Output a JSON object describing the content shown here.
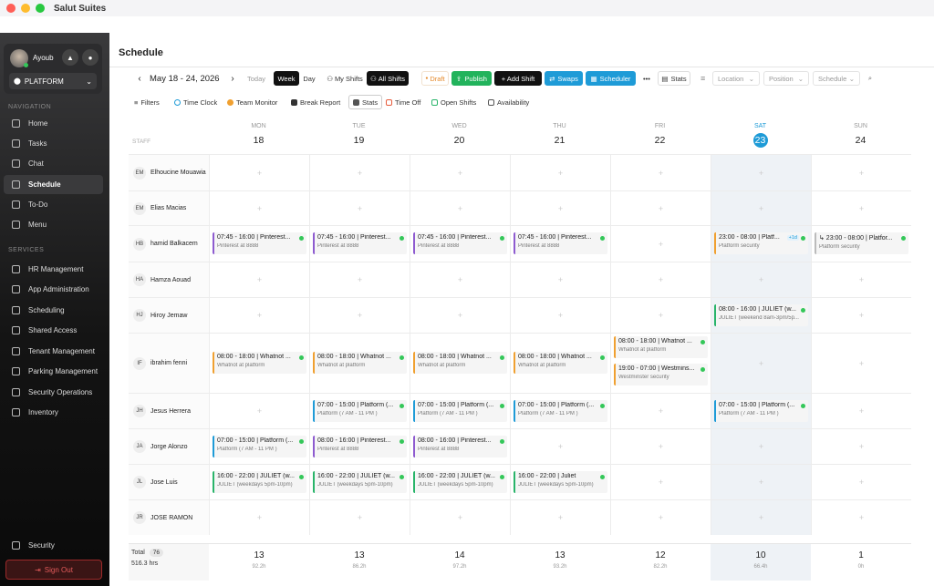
{
  "window": {
    "title": "Salut Suites"
  },
  "user": {
    "name": "Ayoub",
    "platform": "PLATFORM"
  },
  "sidebar": {
    "nav_heading": "NAVIGATION",
    "nav": [
      "Home",
      "Tasks",
      "Chat",
      "Schedule",
      "To-Do",
      "Menu"
    ],
    "services_heading": "SERVICES",
    "services": [
      "HR Management",
      "App Administration",
      "Scheduling",
      "Shared Access",
      "Tenant Management",
      "Parking Management",
      "Security Operations",
      "Inventory"
    ],
    "security": "Security",
    "signout": "Sign Out"
  },
  "page": {
    "title": "Schedule"
  },
  "toolbar": {
    "range": "May 18 - 24, 2026",
    "today": "Today",
    "week": "Week",
    "day": "Day",
    "my_shifts": "My Shifts",
    "all_shifts": "All Shifts",
    "draft": "Draft",
    "publish": "Publish",
    "add_shift": "+ Add Shift",
    "swaps": "Swaps",
    "scheduler": "Scheduler",
    "more": "•••",
    "stats": "Stats",
    "location": "Location",
    "position": "Position",
    "schedule": "Schedule"
  },
  "toolbar2": [
    "Filters",
    "Time Clock",
    "Team Monitor",
    "Break Report",
    "Stats",
    "Time Off",
    "Open Shifts",
    "Availability"
  ],
  "staff_label": "STAFF",
  "days": [
    {
      "name": "MON",
      "date": "18"
    },
    {
      "name": "TUE",
      "date": "19"
    },
    {
      "name": "WED",
      "date": "20"
    },
    {
      "name": "THU",
      "date": "21"
    },
    {
      "name": "FRI",
      "date": "22"
    },
    {
      "name": "SAT",
      "date": "23"
    },
    {
      "name": "SUN",
      "date": "24"
    }
  ],
  "staff": [
    {
      "initials": "EM",
      "name": "Elhoucine Mouawia",
      "shifts": [
        [],
        [],
        [],
        [],
        [],
        [],
        []
      ]
    },
    {
      "initials": "EM",
      "name": "Elias Macias",
      "shifts": [
        [],
        [],
        [],
        [],
        [],
        [],
        []
      ]
    },
    {
      "initials": "HB",
      "name": "hamid Balkacem",
      "shifts": [
        [
          {
            "time": "07:45 - 16:00 | Pinterest...",
            "sub": "Pinterest at 8888",
            "color": "purple"
          }
        ],
        [
          {
            "time": "07:45 - 16:00 | Pinterest...",
            "sub": "Pinterest at 8888",
            "color": "purple"
          }
        ],
        [
          {
            "time": "07:45 - 16:00 | Pinterest...",
            "sub": "Pinterest at 8888",
            "color": "purple"
          }
        ],
        [
          {
            "time": "07:45 - 16:00 | Pinterest...",
            "sub": "Pinterest at 8888",
            "color": "purple"
          }
        ],
        [],
        [
          {
            "time": "23:00 - 08:00 | Platf...",
            "sub": "Platform security",
            "color": "orange",
            "badge": "+1d"
          }
        ],
        [
          {
            "time": "↳ 23:00 - 08:00 | Platfor...",
            "sub": "Platform security",
            "color": "gray"
          }
        ]
      ]
    },
    {
      "initials": "HA",
      "name": "Hamza Aouad",
      "shifts": [
        [],
        [],
        [],
        [],
        [],
        [],
        []
      ]
    },
    {
      "initials": "HJ",
      "name": "Hiroy Jemaw",
      "shifts": [
        [],
        [],
        [],
        [],
        [],
        [
          {
            "time": "08:00 - 16:00 | JULIET (w...",
            "sub": "JULIET (weekend 8am-3pm/5p...",
            "color": "green"
          }
        ],
        []
      ]
    },
    {
      "initials": "IF",
      "name": "ibrahim fenni",
      "shifts": [
        [
          {
            "time": "08:00 - 18:00 | Whatnot ...",
            "sub": "Whatnot at platform",
            "color": "orange"
          }
        ],
        [
          {
            "time": "08:00 - 18:00 | Whatnot ...",
            "sub": "Whatnot at platform",
            "color": "orange"
          }
        ],
        [
          {
            "time": "08:00 - 18:00 | Whatnot ...",
            "sub": "Whatnot at platform",
            "color": "orange"
          }
        ],
        [
          {
            "time": "08:00 - 18:00 | Whatnot ...",
            "sub": "Whatnot at platform",
            "color": "orange"
          }
        ],
        [
          {
            "time": "08:00 - 18:00 | Whatnot ...",
            "sub": "Whatnot at platform",
            "color": "orange"
          },
          {
            "time": "19:00 - 07:00 | Westmins...",
            "sub": "Westminster security",
            "color": "orange"
          }
        ],
        [],
        []
      ]
    },
    {
      "initials": "JH",
      "name": "Jesus Herrera",
      "shifts": [
        [],
        [
          {
            "time": "07:00 - 15:00 | Platform (...",
            "sub": "Platform (7 AM - 11 PM )",
            "color": "blue"
          }
        ],
        [
          {
            "time": "07:00 - 15:00 | Platform (...",
            "sub": "Platform (7 AM - 11 PM )",
            "color": "blue"
          }
        ],
        [
          {
            "time": "07:00 - 15:00 | Platform (...",
            "sub": "Platform (7 AM - 11 PM )",
            "color": "blue"
          }
        ],
        [],
        [
          {
            "time": "07:00 - 15:00 | Platform (...",
            "sub": "Platform (7 AM - 11 PM )",
            "color": "blue"
          }
        ],
        []
      ]
    },
    {
      "initials": "JA",
      "name": "Jorge Alonzo",
      "shifts": [
        [
          {
            "time": "07:00 - 15:00 | Platform (...",
            "sub": "Platform (7 AM - 11 PM )",
            "color": "blue"
          }
        ],
        [
          {
            "time": "08:00 - 16:00 | Pinterest...",
            "sub": "Pinterest at 8888",
            "color": "purple"
          }
        ],
        [
          {
            "time": "08:00 - 16:00 | Pinterest...",
            "sub": "Pinterest at 8888",
            "color": "purple"
          }
        ],
        [],
        [],
        [],
        []
      ]
    },
    {
      "initials": "JL",
      "name": "Jose Luis",
      "shifts": [
        [
          {
            "time": "16:00 - 22:00 | JULIET (w...",
            "sub": "JULIET (weekdays 5pm-10pm)",
            "color": "green"
          }
        ],
        [
          {
            "time": "16:00 - 22:00 | JULIET (w...",
            "sub": "JULIET (weekdays 5pm-10pm)",
            "color": "green"
          }
        ],
        [
          {
            "time": "16:00 - 22:00 | JULIET (w...",
            "sub": "JULIET (weekdays 5pm-10pm)",
            "color": "green"
          }
        ],
        [
          {
            "time": "16:00 - 22:00 | Juliet",
            "sub": "JULIET (weekdays 5pm-10pm)",
            "color": "green"
          }
        ],
        [],
        [],
        []
      ]
    },
    {
      "initials": "JR",
      "name": "JOSE RAMON",
      "shifts": [
        [],
        [],
        [],
        [],
        [],
        [],
        []
      ]
    }
  ],
  "totals": {
    "label": "Total",
    "count": "76",
    "hours": "516.3 hrs",
    "days": [
      {
        "count": "13",
        "hours": "92.2h"
      },
      {
        "count": "13",
        "hours": "86.2h"
      },
      {
        "count": "14",
        "hours": "97.2h"
      },
      {
        "count": "13",
        "hours": "93.2h"
      },
      {
        "count": "12",
        "hours": "82.2h"
      },
      {
        "count": "10",
        "hours": "66.4h"
      },
      {
        "count": "1",
        "hours": "0h"
      }
    ]
  }
}
